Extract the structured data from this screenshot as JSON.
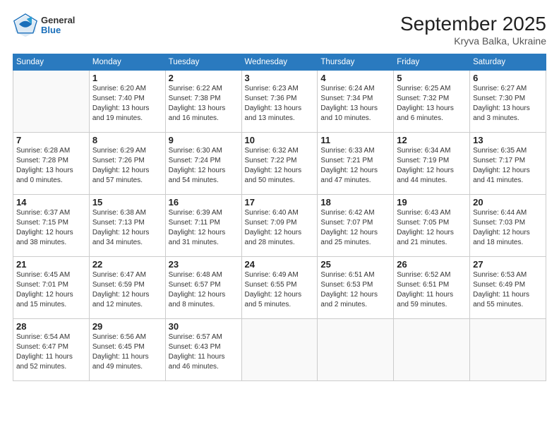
{
  "header": {
    "logo_general": "General",
    "logo_blue": "Blue",
    "month_title": "September 2025",
    "location": "Kryva Balka, Ukraine"
  },
  "days_of_week": [
    "Sunday",
    "Monday",
    "Tuesday",
    "Wednesday",
    "Thursday",
    "Friday",
    "Saturday"
  ],
  "weeks": [
    [
      {
        "day": "",
        "info": ""
      },
      {
        "day": "1",
        "info": "Sunrise: 6:20 AM\nSunset: 7:40 PM\nDaylight: 13 hours\nand 19 minutes."
      },
      {
        "day": "2",
        "info": "Sunrise: 6:22 AM\nSunset: 7:38 PM\nDaylight: 13 hours\nand 16 minutes."
      },
      {
        "day": "3",
        "info": "Sunrise: 6:23 AM\nSunset: 7:36 PM\nDaylight: 13 hours\nand 13 minutes."
      },
      {
        "day": "4",
        "info": "Sunrise: 6:24 AM\nSunset: 7:34 PM\nDaylight: 13 hours\nand 10 minutes."
      },
      {
        "day": "5",
        "info": "Sunrise: 6:25 AM\nSunset: 7:32 PM\nDaylight: 13 hours\nand 6 minutes."
      },
      {
        "day": "6",
        "info": "Sunrise: 6:27 AM\nSunset: 7:30 PM\nDaylight: 13 hours\nand 3 minutes."
      }
    ],
    [
      {
        "day": "7",
        "info": "Sunrise: 6:28 AM\nSunset: 7:28 PM\nDaylight: 13 hours\nand 0 minutes."
      },
      {
        "day": "8",
        "info": "Sunrise: 6:29 AM\nSunset: 7:26 PM\nDaylight: 12 hours\nand 57 minutes."
      },
      {
        "day": "9",
        "info": "Sunrise: 6:30 AM\nSunset: 7:24 PM\nDaylight: 12 hours\nand 54 minutes."
      },
      {
        "day": "10",
        "info": "Sunrise: 6:32 AM\nSunset: 7:22 PM\nDaylight: 12 hours\nand 50 minutes."
      },
      {
        "day": "11",
        "info": "Sunrise: 6:33 AM\nSunset: 7:21 PM\nDaylight: 12 hours\nand 47 minutes."
      },
      {
        "day": "12",
        "info": "Sunrise: 6:34 AM\nSunset: 7:19 PM\nDaylight: 12 hours\nand 44 minutes."
      },
      {
        "day": "13",
        "info": "Sunrise: 6:35 AM\nSunset: 7:17 PM\nDaylight: 12 hours\nand 41 minutes."
      }
    ],
    [
      {
        "day": "14",
        "info": "Sunrise: 6:37 AM\nSunset: 7:15 PM\nDaylight: 12 hours\nand 38 minutes."
      },
      {
        "day": "15",
        "info": "Sunrise: 6:38 AM\nSunset: 7:13 PM\nDaylight: 12 hours\nand 34 minutes."
      },
      {
        "day": "16",
        "info": "Sunrise: 6:39 AM\nSunset: 7:11 PM\nDaylight: 12 hours\nand 31 minutes."
      },
      {
        "day": "17",
        "info": "Sunrise: 6:40 AM\nSunset: 7:09 PM\nDaylight: 12 hours\nand 28 minutes."
      },
      {
        "day": "18",
        "info": "Sunrise: 6:42 AM\nSunset: 7:07 PM\nDaylight: 12 hours\nand 25 minutes."
      },
      {
        "day": "19",
        "info": "Sunrise: 6:43 AM\nSunset: 7:05 PM\nDaylight: 12 hours\nand 21 minutes."
      },
      {
        "day": "20",
        "info": "Sunrise: 6:44 AM\nSunset: 7:03 PM\nDaylight: 12 hours\nand 18 minutes."
      }
    ],
    [
      {
        "day": "21",
        "info": "Sunrise: 6:45 AM\nSunset: 7:01 PM\nDaylight: 12 hours\nand 15 minutes."
      },
      {
        "day": "22",
        "info": "Sunrise: 6:47 AM\nSunset: 6:59 PM\nDaylight: 12 hours\nand 12 minutes."
      },
      {
        "day": "23",
        "info": "Sunrise: 6:48 AM\nSunset: 6:57 PM\nDaylight: 12 hours\nand 8 minutes."
      },
      {
        "day": "24",
        "info": "Sunrise: 6:49 AM\nSunset: 6:55 PM\nDaylight: 12 hours\nand 5 minutes."
      },
      {
        "day": "25",
        "info": "Sunrise: 6:51 AM\nSunset: 6:53 PM\nDaylight: 12 hours\nand 2 minutes."
      },
      {
        "day": "26",
        "info": "Sunrise: 6:52 AM\nSunset: 6:51 PM\nDaylight: 11 hours\nand 59 minutes."
      },
      {
        "day": "27",
        "info": "Sunrise: 6:53 AM\nSunset: 6:49 PM\nDaylight: 11 hours\nand 55 minutes."
      }
    ],
    [
      {
        "day": "28",
        "info": "Sunrise: 6:54 AM\nSunset: 6:47 PM\nDaylight: 11 hours\nand 52 minutes."
      },
      {
        "day": "29",
        "info": "Sunrise: 6:56 AM\nSunset: 6:45 PM\nDaylight: 11 hours\nand 49 minutes."
      },
      {
        "day": "30",
        "info": "Sunrise: 6:57 AM\nSunset: 6:43 PM\nDaylight: 11 hours\nand 46 minutes."
      },
      {
        "day": "",
        "info": ""
      },
      {
        "day": "",
        "info": ""
      },
      {
        "day": "",
        "info": ""
      },
      {
        "day": "",
        "info": ""
      }
    ]
  ]
}
